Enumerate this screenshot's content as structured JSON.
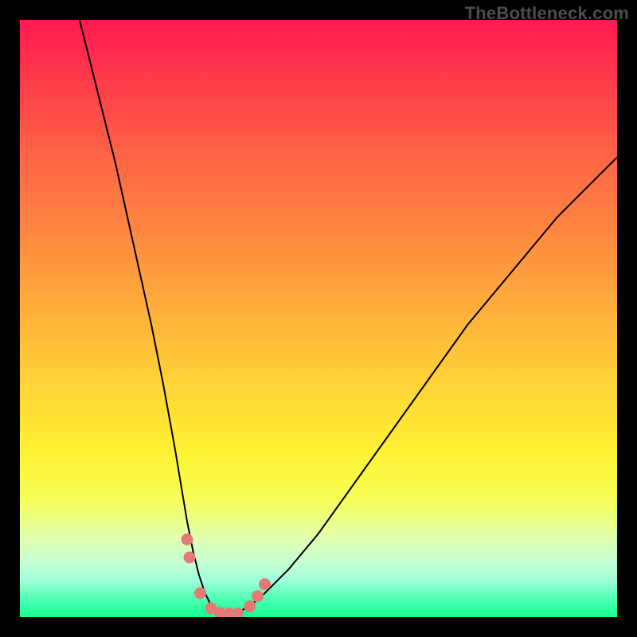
{
  "watermark": "TheBottleneck.com",
  "chart_data": {
    "type": "line",
    "title": "",
    "xlabel": "",
    "ylabel": "",
    "xlim": [
      0,
      100
    ],
    "ylim": [
      0,
      100
    ],
    "curve": {
      "name": "bottleneck-curve",
      "x": [
        10,
        12,
        14,
        16,
        18,
        20,
        22,
        24,
        26,
        27,
        28,
        29,
        30,
        31,
        32,
        33,
        34,
        35,
        37,
        40,
        45,
        50,
        55,
        60,
        65,
        70,
        75,
        80,
        85,
        90,
        95,
        100
      ],
      "y": [
        100,
        92,
        84,
        76,
        67,
        58,
        49,
        39,
        28,
        22,
        16,
        11,
        7,
        4,
        2,
        1,
        0.5,
        0.5,
        1,
        3,
        8,
        14,
        21,
        28,
        35,
        42,
        49,
        55,
        61,
        67,
        72,
        77
      ]
    },
    "markers": [
      {
        "x": 28.0,
        "y": 13
      },
      {
        "x": 28.4,
        "y": 10
      },
      {
        "x": 30.2,
        "y": 4
      },
      {
        "x": 32.0,
        "y": 1.5
      },
      {
        "x": 33.5,
        "y": 0.7
      },
      {
        "x": 35.0,
        "y": 0.6
      },
      {
        "x": 36.5,
        "y": 0.6
      },
      {
        "x": 38.5,
        "y": 1.8
      },
      {
        "x": 39.8,
        "y": 3.5
      },
      {
        "x": 41.0,
        "y": 5.5
      }
    ],
    "marker_radius": 7,
    "colors": {
      "curve": "#000000",
      "markers": "#e47a76",
      "frame": "#000000"
    }
  }
}
